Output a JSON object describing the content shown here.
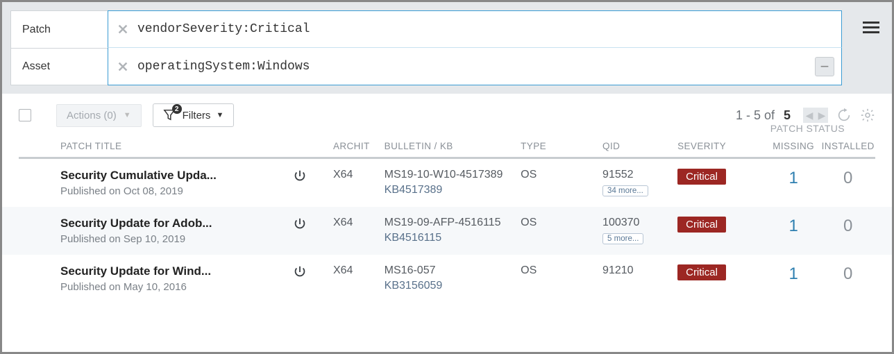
{
  "search": {
    "patch_label": "Patch",
    "patch_query": "vendorSeverity:Critical",
    "asset_label": "Asset",
    "asset_query": "operatingSystem:Windows"
  },
  "toolbar": {
    "actions_label": "Actions (0)",
    "filters_label": "Filters",
    "filters_count": "2",
    "paging_prefix": "1 - 5 of",
    "paging_total": "5"
  },
  "headers": {
    "patch_title": "PATCH TITLE",
    "archit": "ARCHIT",
    "bulletin": "BULLETIN / KB",
    "type": "TYPE",
    "qid": "QID",
    "severity": "SEVERITY",
    "patch_status": "PATCH STATUS",
    "missing": "MISSING",
    "installed": "INSTALLED"
  },
  "rows": [
    {
      "title": "Security Cumulative Upda...",
      "published": "Published on Oct 08, 2019",
      "archit": "X64",
      "bulletin": "MS19-10-W10-4517389",
      "kb": "KB4517389",
      "type": "OS",
      "qid": "91552",
      "qid_more": "34 more...",
      "severity": "Critical",
      "missing": "1",
      "installed": "0"
    },
    {
      "title": "Security Update for Adob...",
      "published": "Published on Sep 10, 2019",
      "archit": "X64",
      "bulletin": "MS19-09-AFP-4516115",
      "kb": "KB4516115",
      "type": "OS",
      "qid": "100370",
      "qid_more": "5 more...",
      "severity": "Critical",
      "missing": "1",
      "installed": "0"
    },
    {
      "title": "Security Update for Wind...",
      "published": "Published on May 10, 2016",
      "archit": "X64",
      "bulletin": "MS16-057",
      "kb": "KB3156059",
      "type": "OS",
      "qid": "91210",
      "qid_more": "",
      "severity": "Critical",
      "missing": "1",
      "installed": "0"
    }
  ]
}
